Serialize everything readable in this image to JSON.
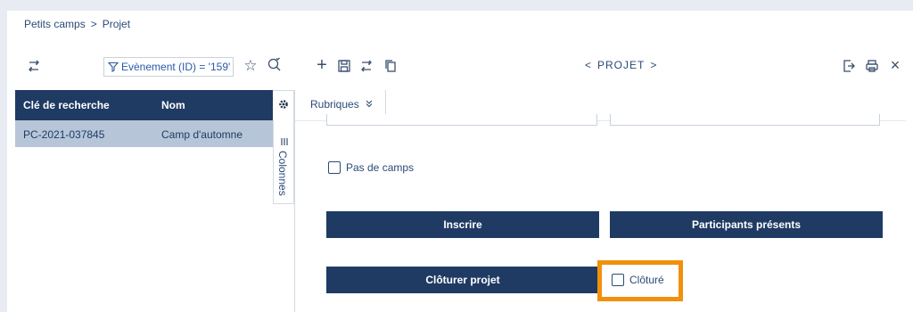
{
  "breadcrumb": {
    "parent": "Petits camps",
    "separator": ">",
    "current": "Projet"
  },
  "left_toolbar": {
    "filter_text": "Evènement (ID) = '159'",
    "icons": [
      "sync-icon",
      "funnel-icon",
      "star-icon",
      "search-settings-icon"
    ]
  },
  "right_toolbar": {
    "record_nav_prev": "<",
    "record_nav_label": "PROJET",
    "record_nav_next": ">",
    "icons": [
      "plus-icon",
      "save-icon",
      "sync-icon",
      "copy-icon",
      "export-icon",
      "print-icon",
      "close-icon"
    ]
  },
  "list": {
    "columns": [
      "Clé de recherche",
      "Nom"
    ],
    "rows": [
      {
        "key": "PC-2021-037845",
        "name": "Camp d'automne"
      }
    ],
    "columns_tab_label": "Colonnes"
  },
  "form": {
    "section_selector": "Rubriques",
    "checkbox_no_camps": "Pas de camps",
    "button_register": "Inscrire",
    "button_participants": "Participants présents",
    "button_close_project": "Clôturer projet",
    "checkbox_closed": "Clôturé"
  },
  "colors": {
    "primary": "#1f3b63",
    "selected_row": "#b6c6d8",
    "highlight": "#f0900c",
    "background": "#e8ecf2"
  }
}
